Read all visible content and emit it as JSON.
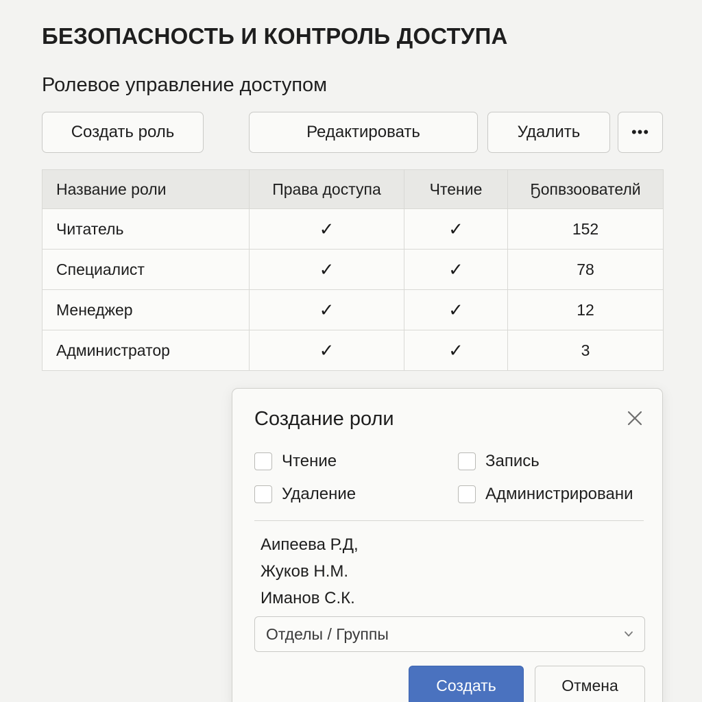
{
  "page": {
    "title": "БЕЗОПАСНОСТЬ И КОНТРОЛЬ ДОСТУПА",
    "section_title": "Ролевое управление доступом"
  },
  "toolbar": {
    "create_label": "Создать роль",
    "edit_label": "Редактировать",
    "delete_label": "Удалить",
    "more_label": "•••"
  },
  "table": {
    "headers": [
      "Название роли",
      "Права доступа",
      "Чтение",
      "Ҕопвзоователй"
    ],
    "rows": [
      {
        "name": "Читатель",
        "access": "✓",
        "read": "✓",
        "users": "152"
      },
      {
        "name": "Специалист",
        "access": "✓",
        "read": "✓",
        "users": "78"
      },
      {
        "name": "Менеджер",
        "access": "✓",
        "read": "✓",
        "users": "12"
      },
      {
        "name": "Администратор",
        "access": "✓",
        "read": "✓",
        "users": "3"
      }
    ]
  },
  "dialog": {
    "title": "Создание роли",
    "close_icon": "close-icon",
    "options": {
      "read": "Чтение",
      "write": "Запись",
      "delete": "Удаление",
      "admin": "Администрировани"
    },
    "users": [
      "Аипеева Р.Д,",
      "Жуков Н.М.",
      "Иманов С.К."
    ],
    "select_value": "Отделы / Группы",
    "submit_label": "Создать",
    "cancel_label": "Отмена"
  },
  "colors": {
    "background": "#f3f3f1",
    "accent": "#4a72bf",
    "header_row": "#e8e8e5"
  }
}
